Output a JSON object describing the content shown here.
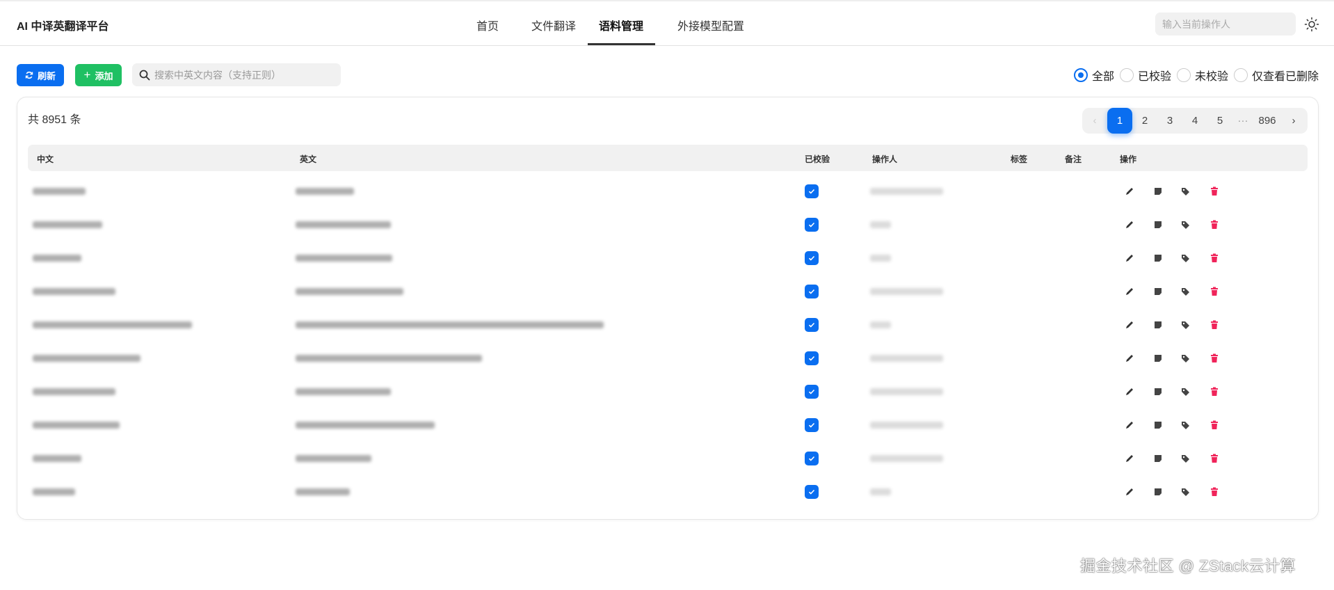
{
  "header": {
    "title": "AI 中译英翻译平台",
    "nav": [
      "首页",
      "文件翻译",
      "语料管理",
      "外接模型配置"
    ],
    "active_nav": "语料管理",
    "operator_placeholder": "输入当前操作人"
  },
  "toolbar": {
    "refresh_label": "刷新",
    "add_label": "添加",
    "search_placeholder": "搜索中英文内容（支持正则）"
  },
  "filters": {
    "options": [
      "全部",
      "已校验",
      "未校验",
      "仅查看已删除"
    ],
    "selected": "全部"
  },
  "summary": {
    "total_text": "共 8951 条"
  },
  "pagination": {
    "pages": [
      "1",
      "2",
      "3",
      "4",
      "5",
      "···",
      "896"
    ],
    "current": "1"
  },
  "table": {
    "columns": [
      "中文",
      "英文",
      "已校验",
      "操作人",
      "标签",
      "备注",
      "操作"
    ],
    "row_count": 10,
    "rows_verified": [
      true,
      true,
      true,
      true,
      true,
      true,
      true,
      true,
      true,
      true
    ]
  },
  "colors": {
    "primary": "#0a6ef0",
    "success": "#1fc063",
    "danger": "#f0245a"
  },
  "watermark": "掘金技术社区 @ ZStack云计算"
}
